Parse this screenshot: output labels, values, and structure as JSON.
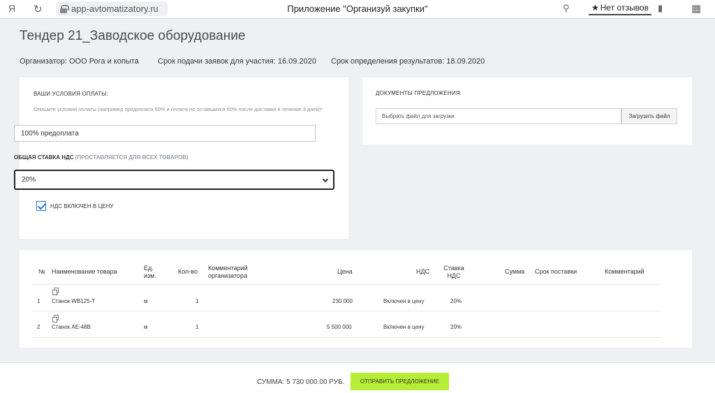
{
  "browser": {
    "logo": "Я",
    "url": "app-avtomatizatory.ru",
    "title": "Приложение \"Организуй закупки\"",
    "reviews_label": "Нет отзывов"
  },
  "page": {
    "title": "Тендер 21_Заводское оборудование",
    "organizer": "Организатор: ООО Рога и копыта",
    "submission_deadline": "Срок подачи заявок для участия: 16.09.2020",
    "results_date": "Срок определения результатов: 18.09.2020"
  },
  "payment": {
    "label": "Ваши условия оплаты:",
    "hint": "Опишите условия оплаты (например предоплата 50% и оплата по оставшихся 50% после доставки в течение 3 дней)*",
    "value": "100% предоплата",
    "vat_label": "Общая ставка НДС",
    "vat_note": "(проставляется для всех товаров)",
    "vat_selected": "20%",
    "vat_included_label": "НДС включен в цену"
  },
  "documents": {
    "label": "Документы предложения:",
    "file_placeholder": "Выбрать файл для загрузки",
    "upload_label": "Загрузить файл"
  },
  "table": {
    "headers": {
      "num": "№",
      "name": "Наименование товара",
      "unit": "Ед. изм.",
      "qty": "Кол-во",
      "org_comment": "Комментарий организатора",
      "price": "Цена",
      "vat": "НДС",
      "vat_rate": "Ставка НДС",
      "sum": "Сумма",
      "delivery": "Срок поставки",
      "comment": "Комментарий"
    },
    "rows": [
      {
        "num": "1",
        "name": "Станок WB125-T",
        "unit": "м",
        "qty": "1",
        "price": "230 000",
        "vat": "Включен в цену",
        "vat_rate": "20%"
      },
      {
        "num": "2",
        "name": "Станок AE-48B",
        "unit": "м",
        "qty": "1",
        "price": "5 500 000",
        "vat": "Включен в цену",
        "vat_rate": "20%"
      }
    ]
  },
  "footer": {
    "sum_label": "Сумма: 5 730 000.00 руб.",
    "submit_label": "Отправить предложение"
  }
}
